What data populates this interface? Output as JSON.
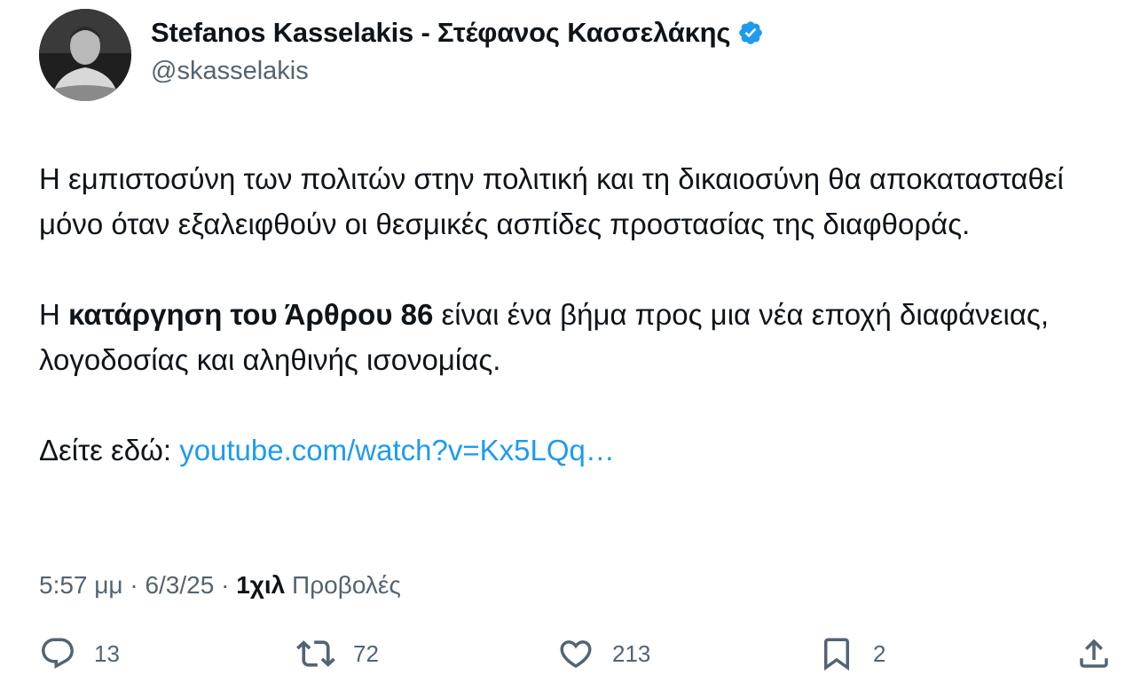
{
  "author": {
    "display_name": "Stefanos Kasselakis - Στέφανος Κασσελάκης",
    "handle": "@skasselakis",
    "verified": true,
    "verified_color": "#1d9bf0"
  },
  "tweet": {
    "paragraph1": "Η εμπιστοσύνη των πολιτών στην πολιτική και τη δικαιοσύνη θα αποκατασταθεί μόνο όταν εξαλειφθούν οι θεσμικές ασπίδες προστασίας της διαφθοράς.",
    "paragraph2_prefix": "Η ",
    "paragraph2_bold": "κατάργηση του Άρθρου 86",
    "paragraph2_suffix": " είναι ένα βήμα προς μια νέα εποχή διαφάνειας, λογοδοσίας και αληθινής ισονομίας.",
    "paragraph3_prefix": "Δείτε εδώ: ",
    "link_text": "youtube.com/watch?v=Kx5LQq…",
    "link_color": "#1d9bf0"
  },
  "meta": {
    "time": "5:57 μμ",
    "separator1": " · ",
    "date": "6/3/25",
    "separator2": " · ",
    "views_count": "1χιλ",
    "views_label": " Προβολές"
  },
  "actions": {
    "reply": {
      "icon": "reply-icon",
      "count": "13"
    },
    "repost": {
      "icon": "repost-icon",
      "count": "72"
    },
    "like": {
      "icon": "heart-icon",
      "count": "213"
    },
    "bookmark": {
      "icon": "bookmark-icon",
      "count": "2"
    },
    "share": {
      "icon": "share-icon"
    }
  }
}
